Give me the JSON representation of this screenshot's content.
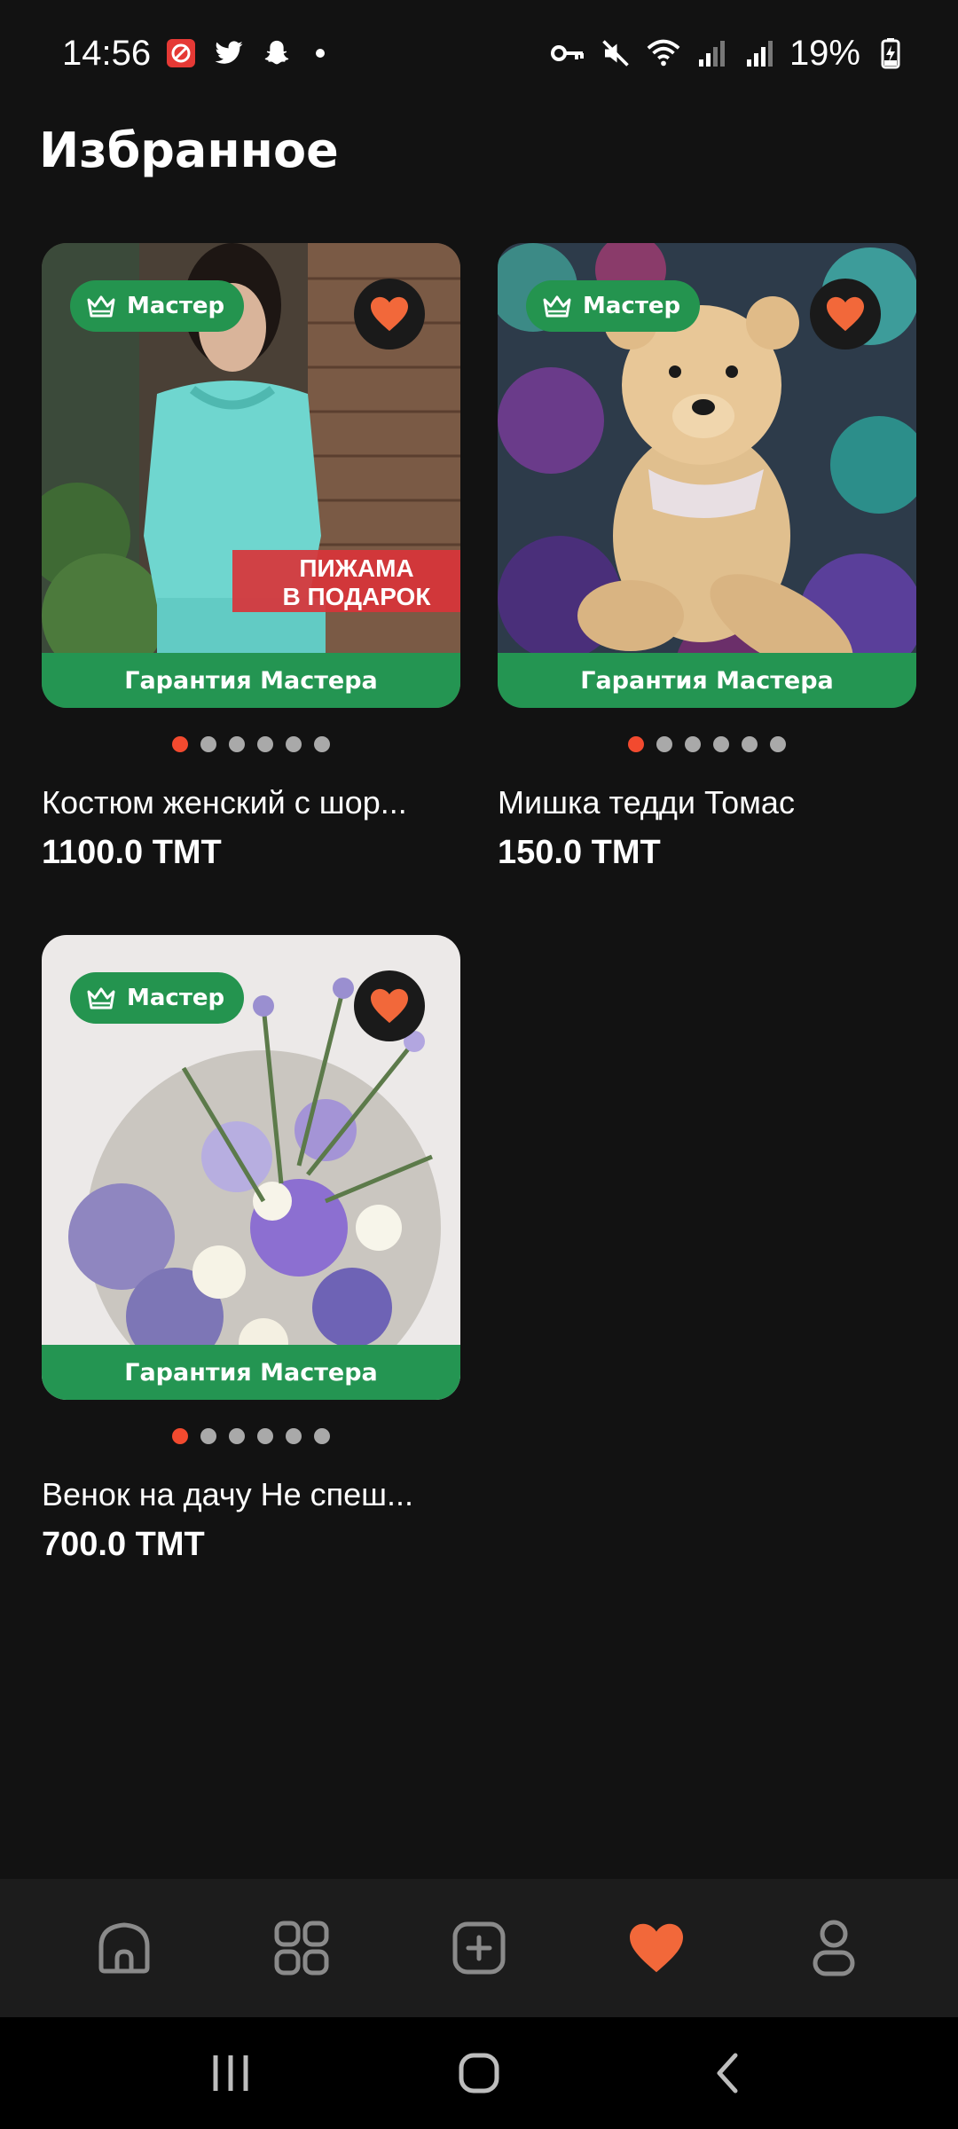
{
  "status_bar": {
    "time": "14:56",
    "battery": "19%",
    "notification_icons": [
      "app-icon",
      "twitter-icon",
      "snapchat-icon"
    ],
    "system_icons": [
      "vpn-key-icon",
      "mute-icon",
      "wifi-icon",
      "signal-icon",
      "signal-icon",
      "battery-charging-icon"
    ]
  },
  "page": {
    "title": "Избранное"
  },
  "products": [
    {
      "badge": "Мастер",
      "guarantee": "Гарантия Мастера",
      "title": "Костюм женский с шор...",
      "price": "1100.0 ТМТ",
      "promo_line1": "ПИЖАМА",
      "promo_line2": "В ПОДАРОК",
      "favorited": true,
      "image_count": 6,
      "active_image": 0
    },
    {
      "badge": "Мастер",
      "guarantee": "Гарантия Мастера",
      "title": "Мишка тедди Томас",
      "price": "150.0 ТМТ",
      "favorited": true,
      "image_count": 6,
      "active_image": 0
    },
    {
      "badge": "Мастер",
      "guarantee": "Гарантия Мастера",
      "title": "Венок на дачу Не спеш...",
      "price": "700.0 ТМТ",
      "favorited": true,
      "image_count": 6,
      "active_image": 0
    }
  ],
  "bottom_nav": {
    "items": [
      "home-icon",
      "catalog-grid-icon",
      "add-listing-icon",
      "favorites-heart-icon",
      "profile-icon"
    ],
    "active": "favorites-heart-icon"
  },
  "system_nav": [
    "recents-icon",
    "home-circle-icon",
    "back-icon"
  ],
  "colors": {
    "background": "#121212",
    "accent_green": "#249552",
    "heart_orange": "#f2683a",
    "dot_active": "#f24a2f"
  }
}
